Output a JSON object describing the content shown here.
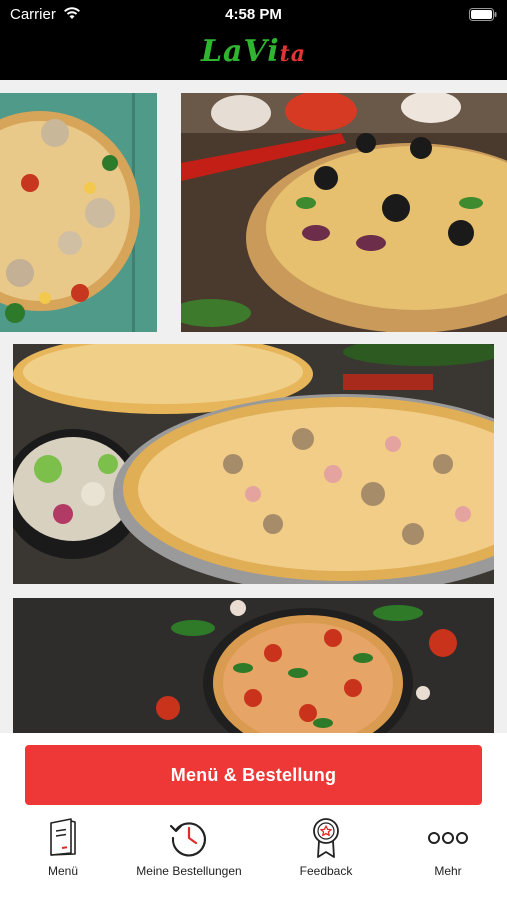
{
  "status_bar": {
    "carrier": "Carrier",
    "time": "4:58 PM"
  },
  "header": {
    "logo_part1": "LaVi",
    "logo_part2": "ta"
  },
  "cta": {
    "label": "Menü & Bestellung"
  },
  "tabs": [
    {
      "label": "Menü",
      "icon": "menu-book-icon"
    },
    {
      "label": "Meine Bestellungen",
      "icon": "history-icon"
    },
    {
      "label": "Feedback",
      "icon": "award-badge-icon"
    },
    {
      "label": "Mehr",
      "icon": "more-dots-icon"
    }
  ],
  "colors": {
    "accent": "#ee3838",
    "logo_green": "#2fb52f",
    "logo_red": "#e13535",
    "header_bg": "#000000"
  }
}
